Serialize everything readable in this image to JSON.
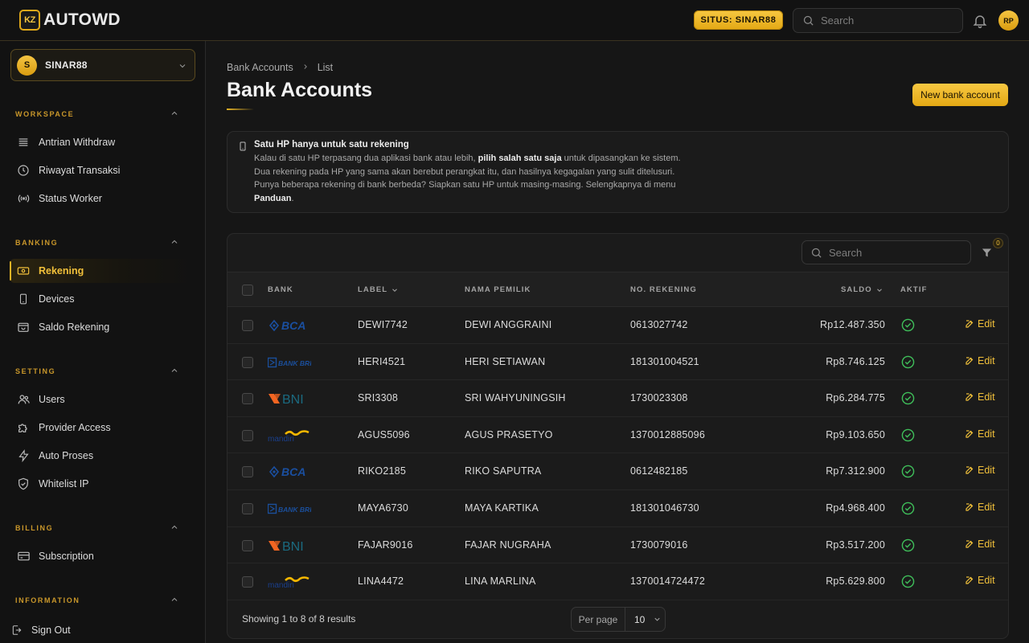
{
  "brand": {
    "badge": "KZ",
    "name": "AUTOWD"
  },
  "header": {
    "site_pill": "SITUS: SINAR88",
    "search_placeholder": "Search",
    "avatar_initials": "RP"
  },
  "sidebar": {
    "tenant": {
      "initial": "S",
      "name": "SINAR88"
    },
    "groups": [
      {
        "title": "WORKSPACE",
        "items": [
          "Antrian Withdraw",
          "Riwayat Transaksi",
          "Status Worker"
        ]
      },
      {
        "title": "BANKING",
        "items": [
          "Rekening",
          "Devices",
          "Saldo Rekening"
        ]
      },
      {
        "title": "SETTING",
        "items": [
          "Users",
          "Provider Access",
          "Auto Proses",
          "Whitelist IP"
        ]
      },
      {
        "title": "BILLING",
        "items": [
          "Subscription"
        ]
      },
      {
        "title": "INFORMATION",
        "items": []
      }
    ],
    "active_item": "Rekening",
    "signout": "Sign Out"
  },
  "breadcrumb": {
    "root": "Bank Accounts",
    "current": "List"
  },
  "page": {
    "title": "Bank Accounts",
    "new_button": "New bank account"
  },
  "notice": {
    "title": "Satu HP hanya untuk satu rekening",
    "line1_a": "Kalau di satu HP terpasang dua aplikasi bank atau lebih, ",
    "line1_b": "pilih salah satu saja",
    "line1_c": " untuk dipasangkan ke sistem.",
    "line2": "Dua rekening pada HP yang sama akan berebut perangkat itu, dan hasilnya kegagalan yang sulit ditelusuri.",
    "line3": "Punya beberapa rekening di bank berbeda? Siapkan satu HP untuk masing-masing. Selengkapnya di menu",
    "line4_a": "Panduan",
    "line4_b": "."
  },
  "table": {
    "search_placeholder": "Search",
    "filter_count": "0",
    "columns": {
      "bank": "BANK",
      "label": "LABEL",
      "owner": "NAMA PEMILIK",
      "account": "NO. REKENING",
      "balance": "SALDO",
      "active": "AKTIF"
    },
    "edit_label": "Edit",
    "rows": [
      {
        "bank": "BCA",
        "label": "DEWI7742",
        "owner": "DEWI ANGGRAINI",
        "account": "0613027742",
        "balance": "Rp12.487.350"
      },
      {
        "bank": "BANK BRI",
        "label": "HERI4521",
        "owner": "HERI SETIAWAN",
        "account": "181301004521",
        "balance": "Rp8.746.125"
      },
      {
        "bank": "BNI",
        "label": "SRI3308",
        "owner": "SRI WAHYUNINGSIH",
        "account": "1730023308",
        "balance": "Rp6.284.775"
      },
      {
        "bank": "mandiri",
        "label": "AGUS5096",
        "owner": "AGUS PRASETYO",
        "account": "1370012885096",
        "balance": "Rp9.103.650"
      },
      {
        "bank": "BCA",
        "label": "RIKO2185",
        "owner": "RIKO SAPUTRA",
        "account": "0612482185",
        "balance": "Rp7.312.900"
      },
      {
        "bank": "BANK BRI",
        "label": "MAYA6730",
        "owner": "MAYA KARTIKA",
        "account": "181301046730",
        "balance": "Rp4.968.400"
      },
      {
        "bank": "BNI",
        "label": "FAJAR9016",
        "owner": "FAJAR NUGRAHA",
        "account": "1730079016",
        "balance": "Rp3.517.200"
      },
      {
        "bank": "mandiri",
        "label": "LINA4472",
        "owner": "LINA MARLINA",
        "account": "1370014724472",
        "balance": "Rp5.629.800"
      }
    ],
    "footer": {
      "showing": "Showing 1 to 8 of 8 results",
      "per_page_label": "Per page",
      "per_page_value": "10"
    }
  },
  "colors": {
    "accent": "#f1c03a",
    "bca": "#1a4fa0",
    "bri": "#1b4f9c",
    "bni_orange": "#f26522",
    "bni_teal": "#1b6a80",
    "mandiri_blue": "#1a3f8c",
    "mandiri_gold": "#f5b700",
    "active_green": "#3fbf5a"
  }
}
